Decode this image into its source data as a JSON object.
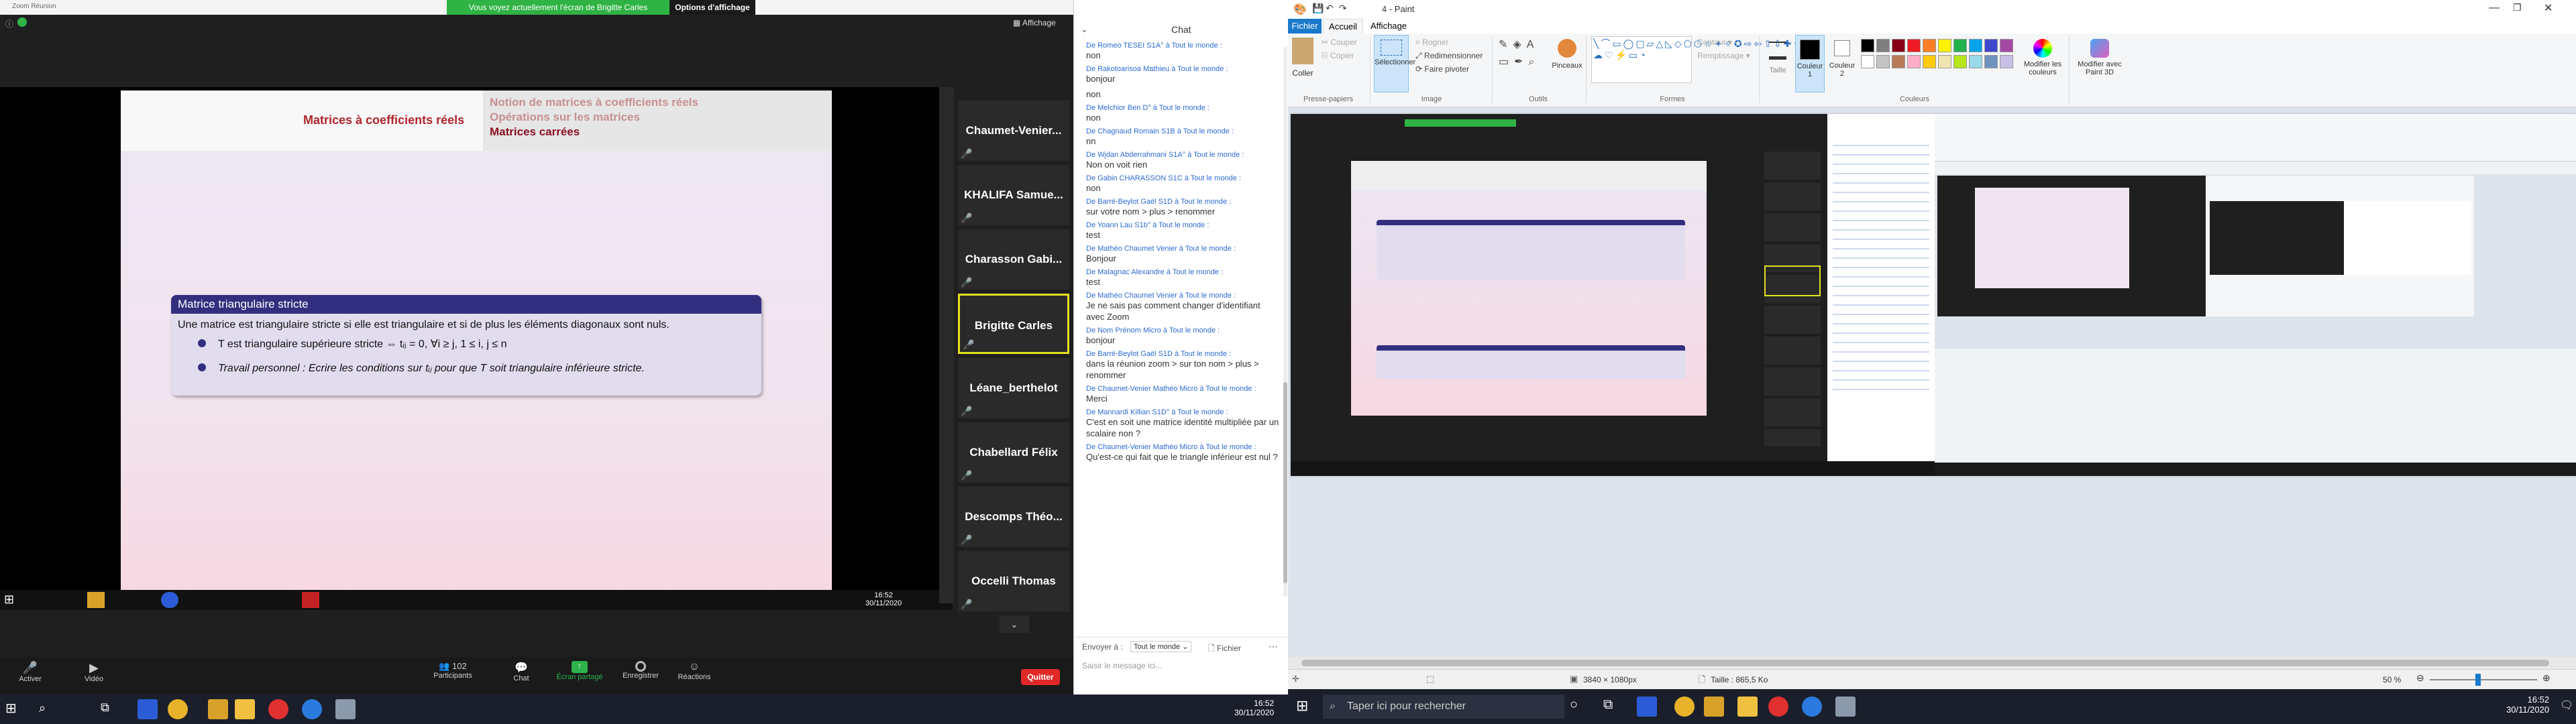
{
  "zoom": {
    "title": "Zoom Réunion",
    "share_banner": "Vous voyez actuellement l'écran de Brigitte Carles",
    "view_options": "Options d'affichage",
    "view_button": "Affichage",
    "slide": {
      "left_title": "Matrices à coefficients réels",
      "nav_1": "Notion de matrices à coefficients réels",
      "nav_2": "Opérations sur les matrices",
      "nav_3": "Matrices carrées",
      "block_title": "Matrice triangulaire stricte",
      "def": "Une matrice est triangulaire stricte si elle est triangulaire et si de plus les éléments diagonaux sont nuls.",
      "item_1": "T est triangulaire supérieure stricte ⇔ tᵢⱼ = 0, ∀i ≥ j, 1 ≤ i, j ≤ n",
      "item_2": "Travail personnel : Ecrire les conditions sur tᵢⱼ pour que T soit triangulaire inférieure stricte."
    },
    "remote_clock": {
      "time": "16:52",
      "date": "30/11/2020"
    },
    "participants": [
      {
        "name": "Chaumet-Venier..."
      },
      {
        "name": "KHALIFA Samue..."
      },
      {
        "name": "Charasson Gabi..."
      },
      {
        "name": "Brigitte Carles"
      },
      {
        "name": "Léane_berthelot"
      },
      {
        "name": "Chabellard Félix"
      },
      {
        "name": "Descomps Théo..."
      },
      {
        "name": "Occelli Thomas"
      }
    ],
    "toolbar": {
      "audio": "Activer",
      "video": "Vidéo",
      "participants": "Participants",
      "participants_count": "102",
      "chat": "Chat",
      "share": "Écran partagé",
      "record": "Enregistrer",
      "reactions": "Réactions",
      "leave": "Quitter"
    }
  },
  "chat": {
    "title": "Chat",
    "messages": [
      {
        "from": "De Romeo TESEI S1A° à Tout le monde :",
        "text": "non"
      },
      {
        "from": "De Rakotoarisoa Mathieu à Tout le monde :",
        "text": "bonjour"
      },
      {
        "from": "",
        "text": "non"
      },
      {
        "from": "De Melchior Ben D° à Tout le monde :",
        "text": "non"
      },
      {
        "from": "De Chagnaud Romain S1B à Tout le monde :",
        "text": "nn"
      },
      {
        "from": "De Wjdan Abderrahmani S1A° à Tout le monde :",
        "text": "Non on voit rien"
      },
      {
        "from": "De Gabin CHARASSON S1C à Tout le monde :",
        "text": "non"
      },
      {
        "from": "De Barré-Beylot Gaël S1D à Tout le monde :",
        "text": "sur votre nom > plus > renommer"
      },
      {
        "from": "De Yoann Lau S1b° à Tout le monde :",
        "text": "test"
      },
      {
        "from": "De Mathéo Chaumet Venier à Tout le monde :",
        "text": "Bonjour"
      },
      {
        "from": "De Malagnac Alexandre à Tout le monde :",
        "text": "test"
      },
      {
        "from": "De Mathéo Chaumet Venier à Tout le monde :",
        "text": "Je ne sais pas comment changer d'identifiant avec Zoom"
      },
      {
        "from": "De Nom Prénom Micro à Tout le monde :",
        "text": "bonjour"
      },
      {
        "from": "De Barré-Beylot Gaël S1D à Tout le monde :",
        "text": "dans la réunion zoom > sur ton nom > plus > renommer"
      },
      {
        "from": "De Chaumet-Venier Mathéo Micro à Tout le monde :",
        "text": "Merci"
      },
      {
        "from": "De Mannardi Killian S1D° à Tout le monde :",
        "text": "C'est en soit une matrice identité multipliée par un scalaire non ?"
      },
      {
        "from": "De Chaumet-Venier Mathéo Micro à Tout le monde :",
        "text": "Qu'est-ce qui fait que le triangle inférieur est nul ?"
      }
    ],
    "send_to_label": "Envoyer à :",
    "send_to_value": "Tout le monde",
    "file_label": "Fichier",
    "input_placeholder": "Saisir le message ici..."
  },
  "paint": {
    "title": "4 - Paint",
    "tabs": {
      "file": "Fichier",
      "home": "Accueil",
      "view": "Affichage"
    },
    "clipboard": {
      "paste": "Coller",
      "cut": "Couper",
      "copy": "Copier",
      "group": "Presse-papiers"
    },
    "image": {
      "select": "Sélectionner",
      "crop": "Rogner",
      "resize": "Redimensionner",
      "rotate": "Faire pivoter",
      "group": "Image"
    },
    "tools": {
      "group": "Outils",
      "brushes": "Pinceaux"
    },
    "shapes": {
      "group": "Formes",
      "outline": "Contour",
      "fill": "Remplissage"
    },
    "size": "Taille",
    "color1": "Couleur 1",
    "color2": "Couleur 2",
    "colors_group": "Couleurs",
    "edit_colors": "Modifier les couleurs",
    "paint3d": "Modifier avec Paint 3D",
    "palette": [
      "#000000",
      "#7f7f7f",
      "#880015",
      "#ed1c24",
      "#ff7f27",
      "#fff200",
      "#22b14c",
      "#00a2e8",
      "#3f48cc",
      "#a349a4",
      "#ffffff",
      "#c3c3c3",
      "#b97a57",
      "#ffaec9",
      "#ffc90e",
      "#efe4b0",
      "#b5e61d",
      "#99d9ea",
      "#7092be",
      "#c8bfe7"
    ],
    "status_dims": "3840 × 1080px",
    "status_size": "Taille : 865,5 Ko",
    "zoom_level": "50 %"
  },
  "taskbar_left": {
    "time": "16:52",
    "date": "30/11/2020"
  },
  "taskbar_right": {
    "search": "Taper ici pour rechercher",
    "time": "16:52",
    "date": "30/11/2020"
  }
}
